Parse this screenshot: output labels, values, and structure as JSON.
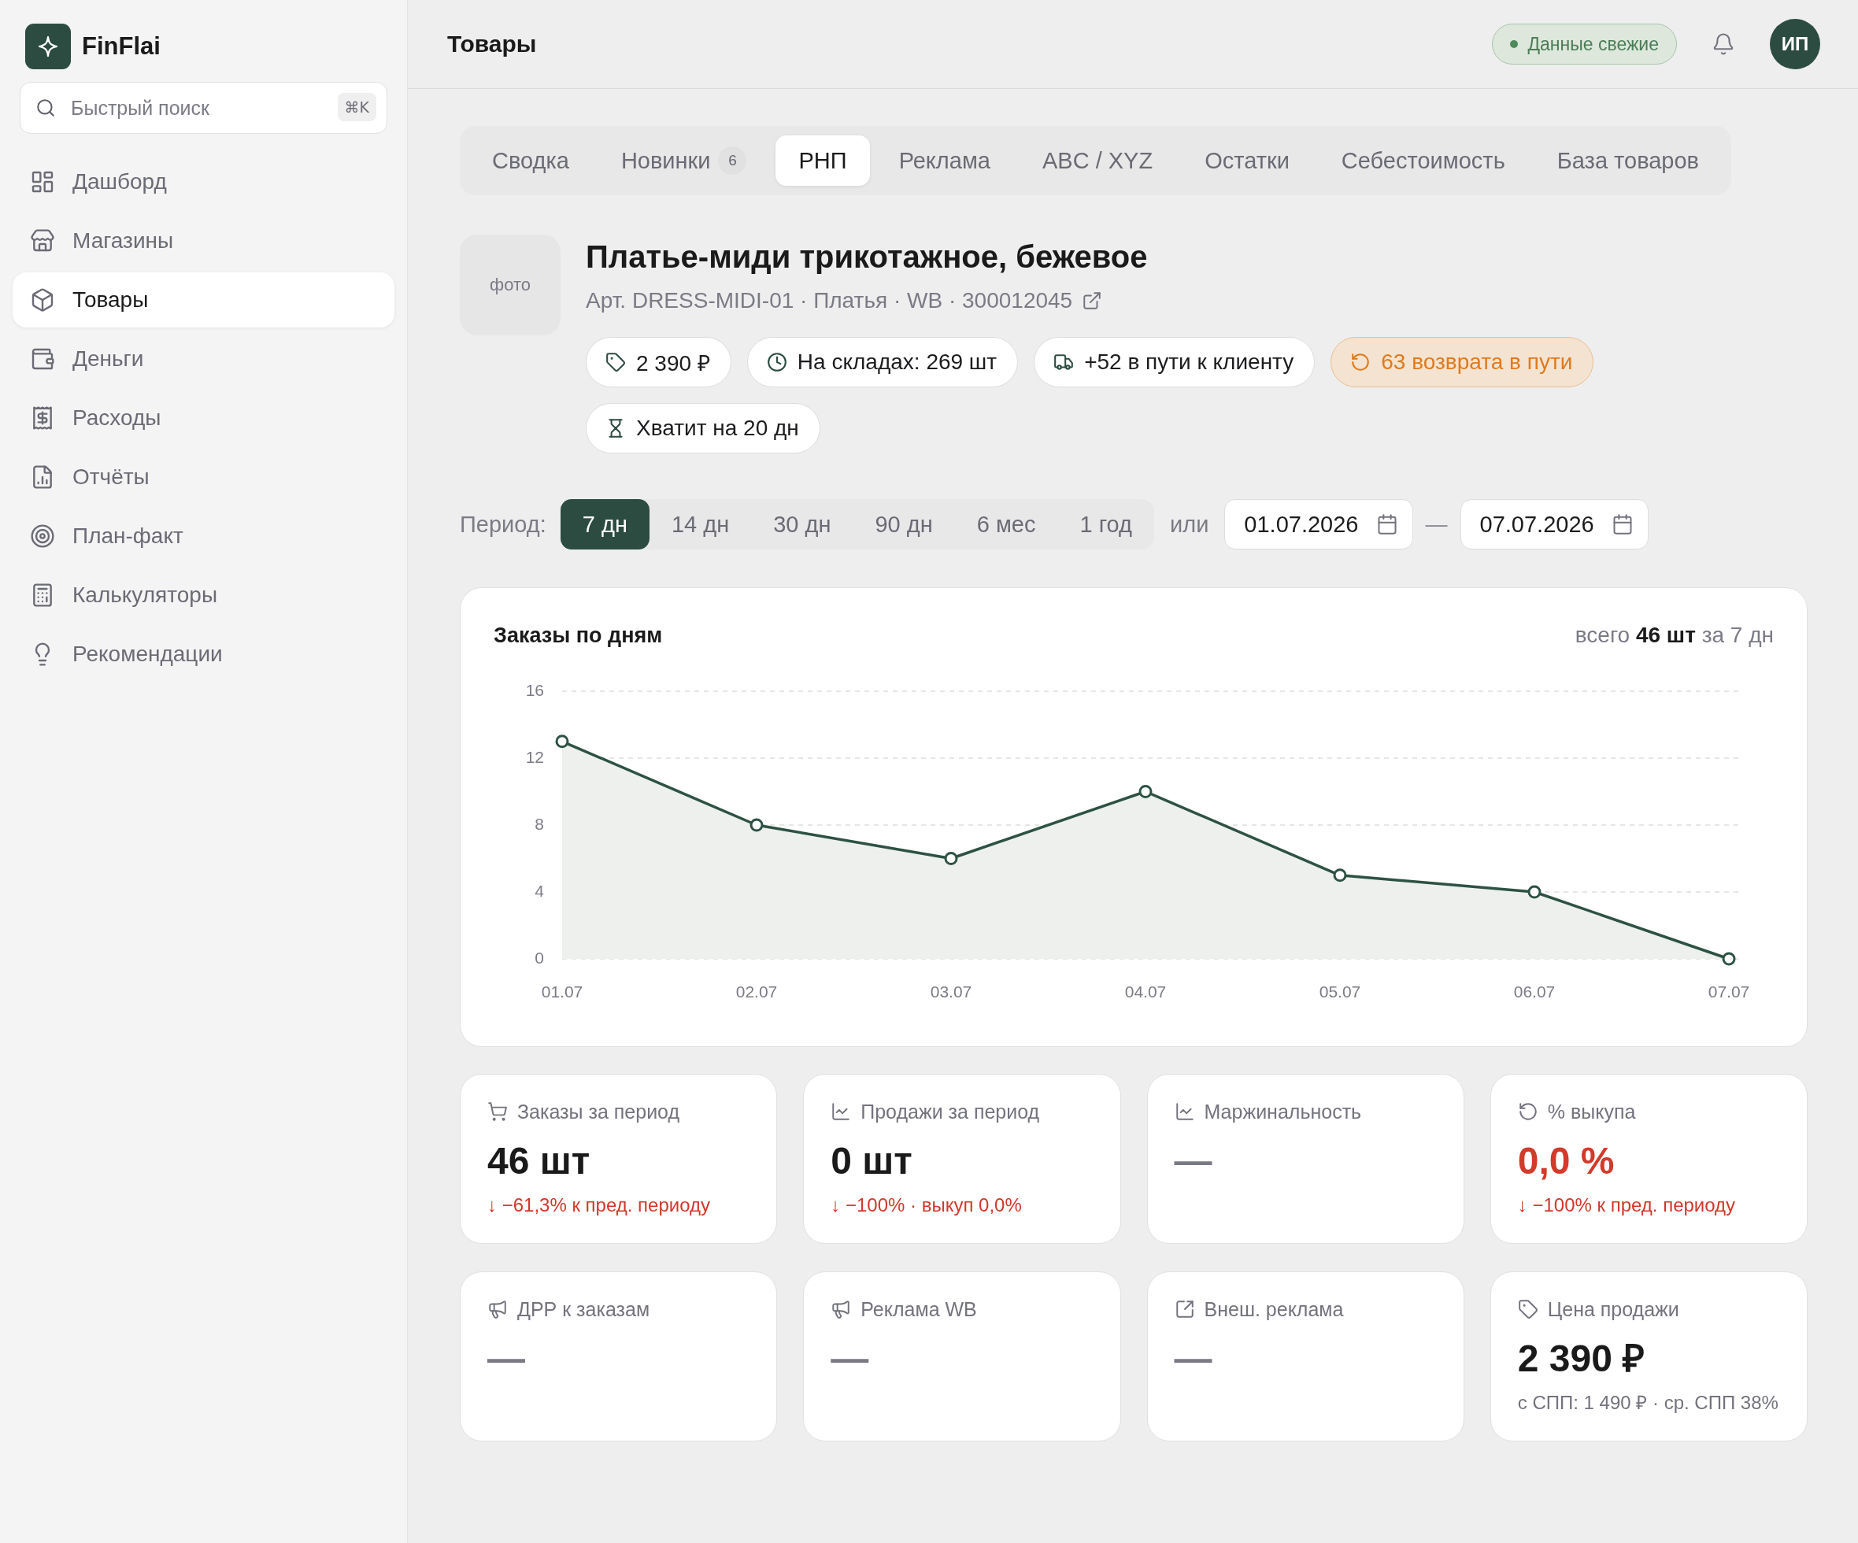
{
  "sidebar": {
    "brand": "FinFlai",
    "search": {
      "placeholder": "Быстрый поиск",
      "shortcut": "⌘K"
    },
    "items": [
      {
        "label": "Дашборд",
        "selected": false
      },
      {
        "label": "Магазины",
        "selected": false
      },
      {
        "label": "Товары",
        "selected": true
      },
      {
        "label": "Деньги",
        "selected": false
      },
      {
        "label": "Расходы",
        "selected": false
      },
      {
        "label": "Отчёты",
        "selected": false
      },
      {
        "label": "План-факт",
        "selected": false
      },
      {
        "label": "Калькуляторы",
        "selected": false
      },
      {
        "label": "Рекомендации",
        "selected": false
      }
    ]
  },
  "header": {
    "title": "Товары",
    "status": "Данные свежие",
    "avatar": "ИП"
  },
  "tabs": [
    {
      "label": "Сводка",
      "selected": false
    },
    {
      "label": "Новинки",
      "badge": "6",
      "selected": false
    },
    {
      "label": "РНП",
      "selected": true
    },
    {
      "label": "Реклама",
      "selected": false
    },
    {
      "label": "ABC / XYZ",
      "selected": false
    },
    {
      "label": "Остатки",
      "selected": false
    },
    {
      "label": "Себестоимость",
      "selected": false
    },
    {
      "label": "База товаров",
      "selected": false
    }
  ],
  "product": {
    "photo": "фото",
    "title": "Платье-миди трикотажное, бежевое",
    "subtitle": "Арт. DRESS-MIDI-01 · Платья · WB · 300012045",
    "chips": [
      {
        "label": "2 390 ₽",
        "kind": "neutral"
      },
      {
        "label": "На складах: 269 шт",
        "kind": "neutral"
      },
      {
        "label": "+52 в пути к клиенту",
        "kind": "neutral"
      },
      {
        "label": "63 возврата в пути",
        "kind": "warning"
      },
      {
        "label": "Хватит на 20 дн",
        "kind": "neutral"
      }
    ]
  },
  "period": {
    "label": "Период:",
    "options": [
      {
        "label": "7 дн",
        "selected": true
      },
      {
        "label": "14 дн",
        "selected": false
      },
      {
        "label": "30 дн",
        "selected": false
      },
      {
        "label": "90 дн",
        "selected": false
      },
      {
        "label": "6 мес",
        "selected": false
      },
      {
        "label": "1 год",
        "selected": false
      }
    ],
    "or_label": "или",
    "date_from": "01.07.2026",
    "separator": "—",
    "date_to": "07.07.2026"
  },
  "chart": {
    "title": "Заказы по дням",
    "summary": "всего **46 шт** за 7 дн",
    "chart_data": {
      "type": "area",
      "categories": [
        "01.07",
        "02.07",
        "03.07",
        "04.07",
        "05.07",
        "06.07",
        "07.07"
      ],
      "series": [
        {
          "color": "#2d5244",
          "values": [
            13,
            8,
            6,
            10,
            5,
            4,
            0
          ]
        }
      ],
      "ylim": [
        0,
        16
      ],
      "yticks": [
        0,
        4,
        8,
        12,
        16
      ],
      "grid": true
    }
  },
  "metrics": [
    {
      "label": "Заказы за период",
      "value": "46 шт",
      "kind": "normal",
      "note": {
        "text": "↓ −61,3% к пред. периоду",
        "kind": "down"
      }
    },
    {
      "label": "Продажи за период",
      "value": "0 шт",
      "kind": "normal",
      "note": {
        "text": "↓ −100% · выкуп 0,0%",
        "kind": "down"
      }
    },
    {
      "label": "Маржинальность",
      "value": "—",
      "kind": "empty"
    },
    {
      "label": "% выкупа",
      "value": "0,0 %",
      "kind": "alert",
      "note": {
        "text": "↓ −100% к пред. периоду",
        "kind": "down"
      }
    },
    {
      "label": "ДРР к заказам",
      "value": "—",
      "kind": "empty"
    },
    {
      "label": "Реклама WB",
      "value": "—",
      "kind": "empty"
    },
    {
      "label": "Внеш. реклама",
      "value": "—",
      "kind": "empty"
    },
    {
      "label": "Цена продажи",
      "value": "2 390 ₽",
      "kind": "normal",
      "note": {
        "text": "с СПП: 1 490 ₽ · ср. СПП 38%",
        "kind": "info"
      }
    }
  ]
}
